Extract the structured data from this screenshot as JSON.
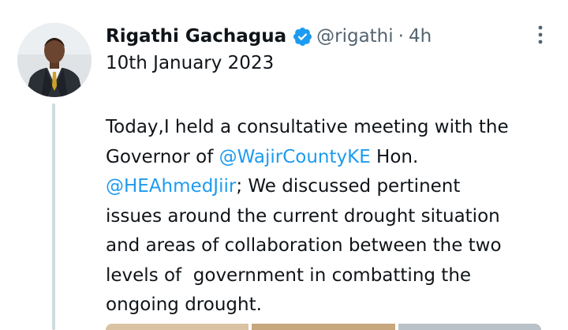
{
  "tweet": {
    "author": {
      "display_name": "Rigathi Gachagua",
      "verified": true,
      "handle": "@rigathi",
      "separator": "·",
      "time_ago": "4h"
    },
    "date_line": "10th January 2023",
    "body_lines": [
      [
        {
          "text": "Today,I held a consultative meeting with the"
        }
      ],
      [
        {
          "text": "Governor of "
        },
        {
          "text": "@WajirCountyKE",
          "mention": true
        },
        {
          "text": " Hon."
        }
      ],
      [
        {
          "text": "@HEAhmedJiir",
          "mention": true
        },
        {
          "text": "; We discussed pertinent"
        }
      ],
      [
        {
          "text": "issues around the current drought situation"
        }
      ],
      [
        {
          "text": "and areas of collaboration between the two"
        }
      ],
      [
        {
          "text": "levels of  government in combatting the"
        }
      ],
      [
        {
          "text": "ongoing drought."
        }
      ]
    ]
  },
  "icons": {
    "verified": "verified-badge-icon",
    "more": "more-vertical-icon"
  },
  "colors": {
    "text_primary": "#0f1419",
    "text_secondary": "#536471",
    "link": "#1d9bf0",
    "thread_line": "#cfd9de",
    "background": "#ffffff"
  }
}
